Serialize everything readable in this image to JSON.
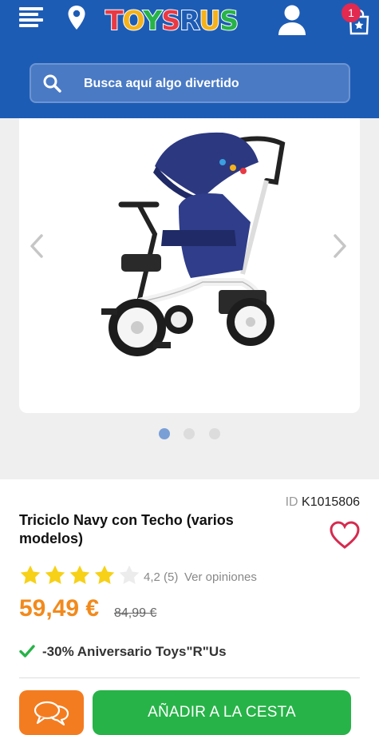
{
  "header": {
    "logo_text": "TOYS R US",
    "cart_count": "1",
    "colors": {
      "header_bg": "#1d5cb5",
      "logo_red": "#e83a44",
      "badge": "#e2294f"
    }
  },
  "search": {
    "placeholder": "Busca aquí algo divertido"
  },
  "carousel": {
    "image": "tricycle-navy-image",
    "slides": 3,
    "active_slide": 1
  },
  "product": {
    "id_label": "ID",
    "id_value": "K1015806",
    "title": "Triciclo Navy con Techo (varios modelos)",
    "rating_stars": 4,
    "rating_text": "4,2 (5)",
    "reviews_link": "Ver opiniones",
    "price": "59,49 €",
    "old_price": "84,99 €",
    "promo": "-30% Aniversario Toys\"R\"Us",
    "colors": {
      "price": "#f28a1c",
      "heart": "#d62a4f",
      "check": "#27b348"
    }
  },
  "actions": {
    "add_to_cart": "AÑADIR A LA CESTA",
    "colors": {
      "chat": "#f47c20",
      "add": "#27b348"
    }
  }
}
